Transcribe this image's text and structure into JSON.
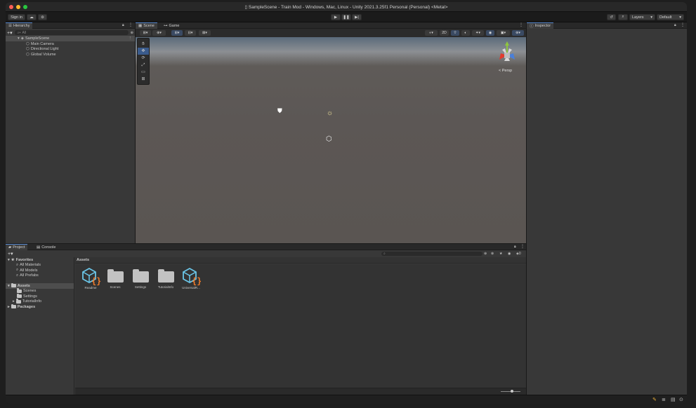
{
  "window": {
    "title": "SampleScene - Train Mod - Windows, Mac, Linux - Unity 2021.3.25f1 Personal (Personal) <Metal>"
  },
  "toolbar": {
    "sign_in": "Sign in",
    "layers": "Layers",
    "layout": "Default"
  },
  "hierarchy": {
    "tab": "Hierarchy",
    "search_placeholder": "All",
    "scene": "SampleScene",
    "items": [
      "Main Camera",
      "Directional Light",
      "Global Volume"
    ]
  },
  "scene_view": {
    "tabs": [
      "Scene",
      "Game"
    ],
    "toggle_2d": "2D",
    "persp_label": "< Persp"
  },
  "inspector": {
    "tab": "Inspector"
  },
  "project": {
    "tabs": [
      "Project",
      "Console"
    ],
    "favorites_label": "Favorites",
    "favorites": [
      "All Materials",
      "All Models",
      "All Prefabs"
    ],
    "assets_label": "Assets",
    "asset_folders": [
      "Scenes",
      "Settings",
      "TutorialInfo"
    ],
    "packages_label": "Packages",
    "breadcrumb": "Assets",
    "grid": [
      "Readme",
      "Scenes",
      "Settings",
      "TutorialInfo",
      "UniversalR..."
    ],
    "hidden_count": "0"
  },
  "colors": {
    "accent": "#5a8bd1",
    "panel": "#383838",
    "background": "#191919"
  }
}
